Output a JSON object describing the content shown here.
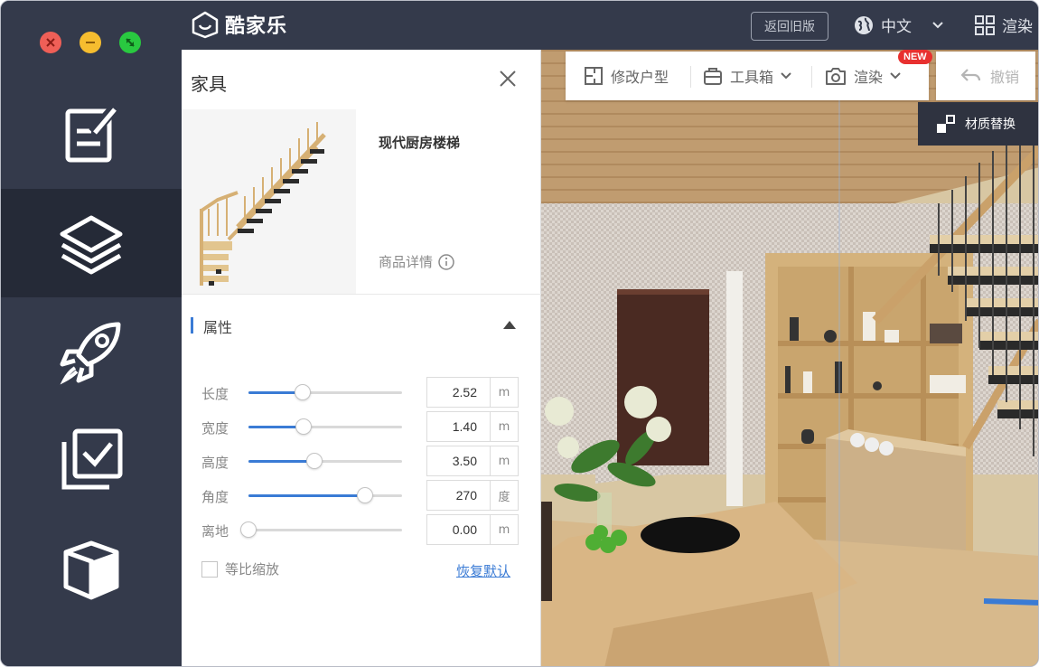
{
  "app": {
    "brand": "酷家乐"
  },
  "topbar": {
    "old_version": "返回旧版",
    "language": "中文",
    "render": "渲染"
  },
  "rail": {
    "items": [
      {
        "icon": "edit-note-icon"
      },
      {
        "icon": "layers-icon",
        "active": true
      },
      {
        "icon": "rocket-icon"
      },
      {
        "icon": "checklist-icon"
      },
      {
        "icon": "cube-icon"
      }
    ]
  },
  "panel": {
    "title": "家具",
    "product_name": "现代厨房楼梯",
    "product_detail": "商品详情",
    "section_title": "属性",
    "rows": [
      {
        "label": "长度",
        "value": "2.52",
        "unit": "m",
        "fraction": 0.35
      },
      {
        "label": "宽度",
        "value": "1.40",
        "unit": "m",
        "fraction": 0.36
      },
      {
        "label": "高度",
        "value": "3.50",
        "unit": "m",
        "fraction": 0.43
      },
      {
        "label": "角度",
        "value": "270",
        "unit": "度",
        "fraction": 0.76
      },
      {
        "label": "离地",
        "value": "0.00",
        "unit": "m",
        "fraction": 0.0
      }
    ],
    "proportional": "等比缩放",
    "reset": "恢复默认"
  },
  "viewport": {
    "toolbar": {
      "edit_floor": "修改户型",
      "toolbox": "工具箱",
      "render": "渲染",
      "new_badge": "NEW"
    },
    "undo": "撤销",
    "material_swap": "材质替换"
  },
  "colors": {
    "sidebar": "#343a4b",
    "sidebar_active": "#252a37",
    "accent": "#3a7bd5",
    "badge": "#e8302f"
  }
}
